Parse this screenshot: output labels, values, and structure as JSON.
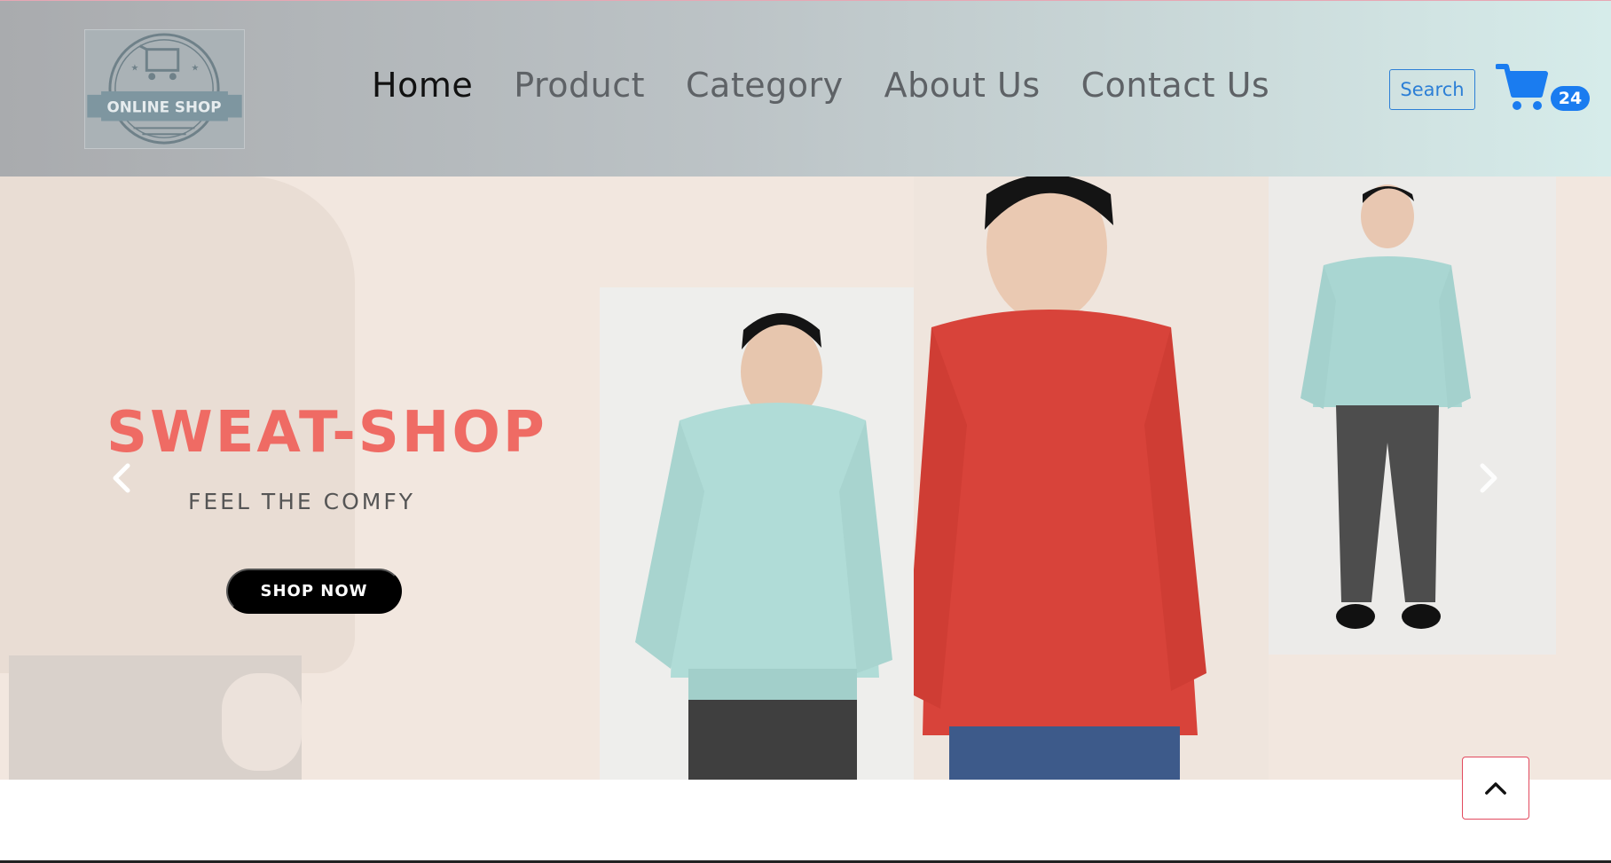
{
  "header": {
    "logo": {
      "text": "ONLINE SHOP",
      "icon": "cart-logo-icon"
    },
    "nav": [
      {
        "label": "Home",
        "active": true
      },
      {
        "label": "Product",
        "active": false
      },
      {
        "label": "Category",
        "active": false
      },
      {
        "label": "About Us",
        "active": false
      },
      {
        "label": "Contact Us",
        "active": false
      }
    ],
    "search_label": "Search",
    "cart": {
      "icon": "cart-icon",
      "count": "24"
    }
  },
  "hero": {
    "title": "SWEAT-SHOP",
    "subtitle": "FEEL THE COMFY",
    "cta_label": "SHOP NOW",
    "prev_icon": "chevron-left-icon",
    "next_icon": "chevron-right-icon"
  },
  "back_to_top": {
    "icon": "chevron-up-icon"
  },
  "colors": {
    "accent_blue": "#1a7cf0",
    "title_red": "#ef6b64",
    "back_top_border": "#e24a5e",
    "hero_bg": "#f2e7df"
  }
}
